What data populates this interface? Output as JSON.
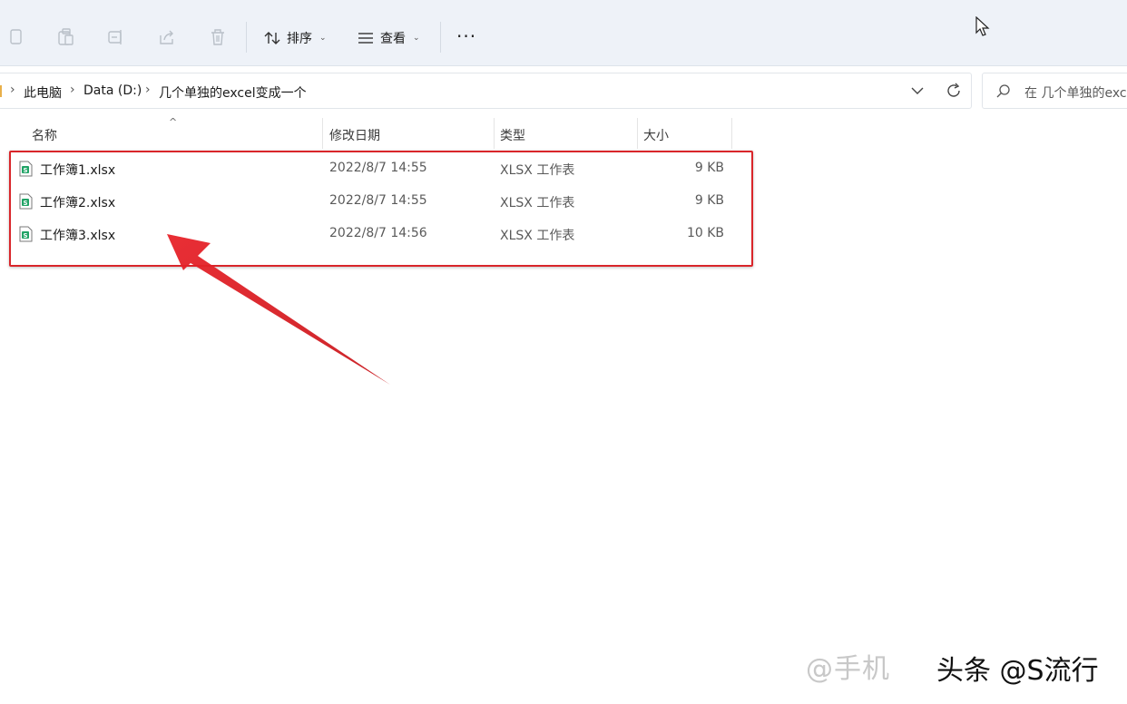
{
  "toolbar": {
    "sort_label": "排序",
    "view_label": "查看",
    "more_label": "···",
    "icons": [
      "copy-icon",
      "paste-icon",
      "rename-icon",
      "share-icon",
      "delete-icon"
    ]
  },
  "address": {
    "crumbs": [
      "此电脑",
      "Data (D:)",
      "几个单独的excel变成一个"
    ],
    "separator": "›"
  },
  "search": {
    "placeholder": "在 几个单独的excel"
  },
  "columns": {
    "name": "名称",
    "modified": "修改日期",
    "type": "类型",
    "size": "大小"
  },
  "files": [
    {
      "name": "工作簿1.xlsx",
      "modified": "2022/8/7 14:55",
      "type": "XLSX 工作表",
      "size": "9 KB"
    },
    {
      "name": "工作簿2.xlsx",
      "modified": "2022/8/7 14:55",
      "type": "XLSX 工作表",
      "size": "9 KB"
    },
    {
      "name": "工作簿3.xlsx",
      "modified": "2022/8/7 14:56",
      "type": "XLSX 工作表",
      "size": "10 KB"
    }
  ],
  "watermark": {
    "faded": "@手机",
    "text": "头条 @S流行"
  },
  "colors": {
    "toolbar_bg": "#eef2f8",
    "highlight": "#d9252a",
    "excel_green": "#21a366"
  }
}
